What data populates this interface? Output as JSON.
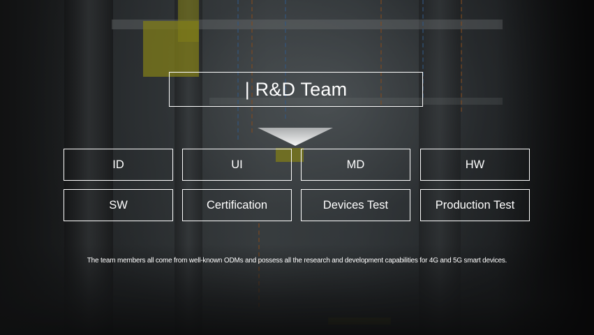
{
  "section": {
    "title": "| R&D Team",
    "teams": [
      "ID",
      "UI",
      "MD",
      "HW",
      "SW",
      "Certification",
      "Devices Test",
      "Production Test"
    ],
    "description": "The team members all come from well-known ODMs and possess all the research and development capabilities for 4G and 5G smart devices."
  }
}
